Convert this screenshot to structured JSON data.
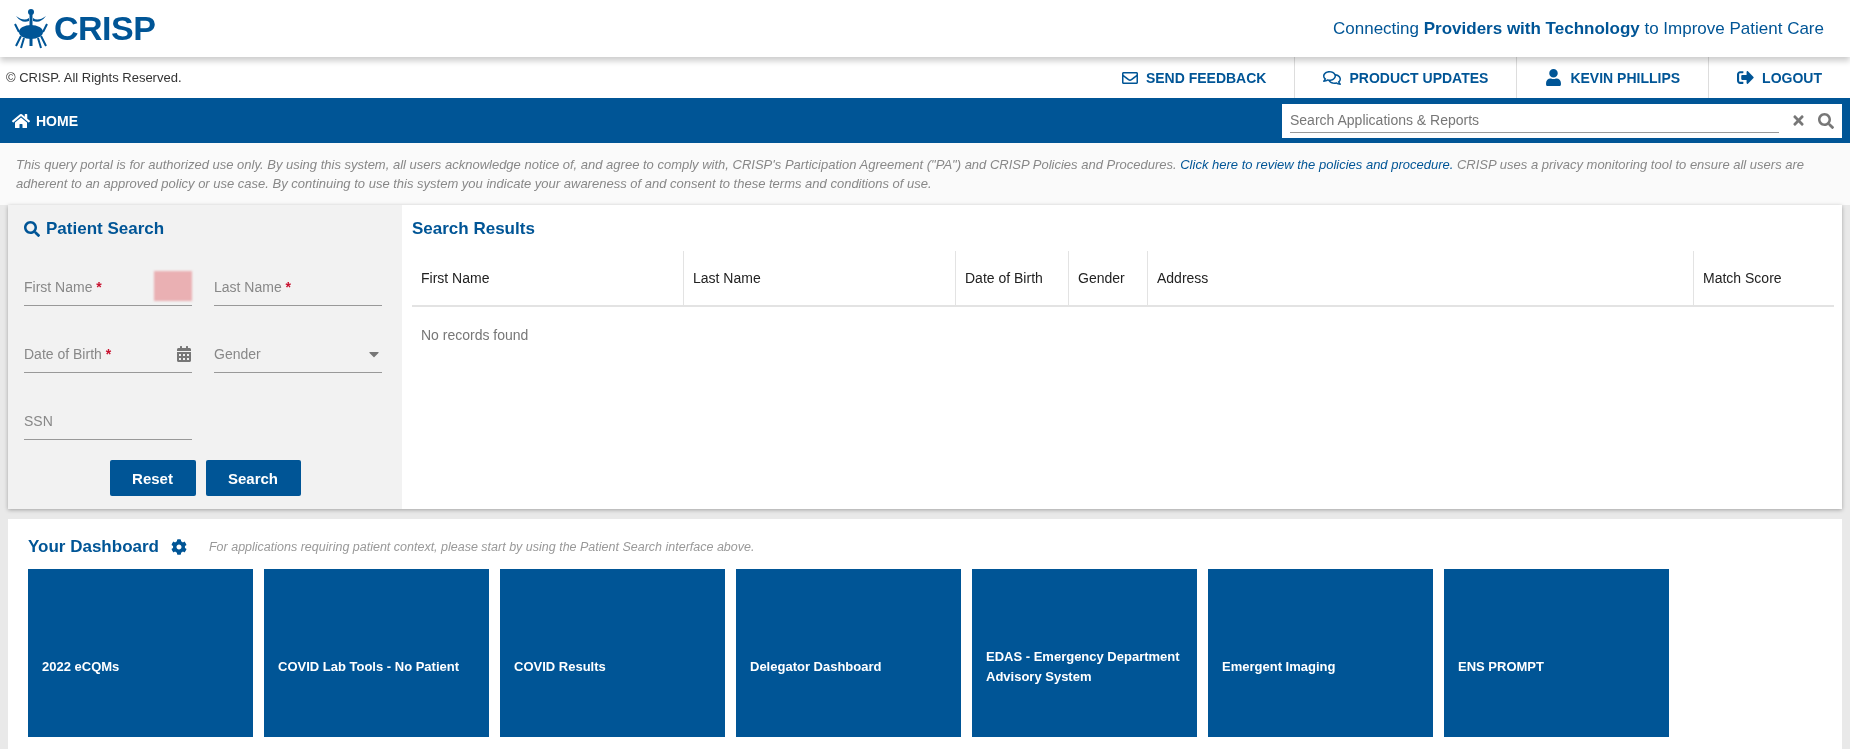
{
  "header": {
    "logo": "CRISP",
    "tagline": "Connecting **Providers with Technology** to Improve Patient Care"
  },
  "topbar": {
    "copyright": "© CRISP. All Rights Reserved.",
    "links": [
      {
        "kind": "feedback",
        "label": "SEND FEEDBACK"
      },
      {
        "kind": "updates",
        "label": "PRODUCT UPDATES"
      },
      {
        "kind": "user",
        "label": "KEVIN PHILLIPS"
      },
      {
        "kind": "logout",
        "label": "LOGOUT"
      }
    ]
  },
  "navbar": {
    "home": "HOME",
    "search": {
      "placeholder": "Search Applications & Reports"
    }
  },
  "notice": {
    "before": "This query portal is for authorized use only. By using this system, all users acknowledge notice of, and agree to comply with, CRISP's Participation Agreement (\"PA\") and CRISP Policies and Procedures.",
    "link": "Click here to review the policies and procedure.",
    "after": "CRISP uses a privacy monitoring tool to ensure all users are adherent to an approved policy or use case. By continuing to use this system you indicate your awareness of and consent to these terms and conditions of use."
  },
  "patient_search": {
    "title": "Patient Search",
    "required_mark": "*",
    "fields": [
      {
        "kind": "text",
        "placeholder": "First Name",
        "required": true
      },
      {
        "kind": "text",
        "placeholder": "Last Name",
        "required": true
      },
      {
        "kind": "date",
        "placeholder": "Date of Birth",
        "required": true
      },
      {
        "kind": "select",
        "placeholder": "Gender",
        "required": false
      },
      {
        "kind": "text",
        "placeholder": "SSN",
        "required": false
      }
    ],
    "buttons": [
      "Reset",
      "Search"
    ]
  },
  "results": {
    "title": "Search Results",
    "columns": [
      "First Name",
      "Last Name",
      "Date of Birth",
      "Gender",
      "Address",
      "Match Score"
    ],
    "empty": "No records found"
  },
  "dashboard": {
    "title": "Your Dashboard",
    "hint": "For applications requiring patient context, please start by using the Patient Search interface above.",
    "tiles": [
      "2022 eCQMs",
      "COVID Lab Tools - No Patient",
      "COVID Results",
      "Delegator Dashboard",
      "EDAS - Emergency Department Advisory System",
      "Emergent Imaging",
      "ENS PROMPT"
    ]
  }
}
